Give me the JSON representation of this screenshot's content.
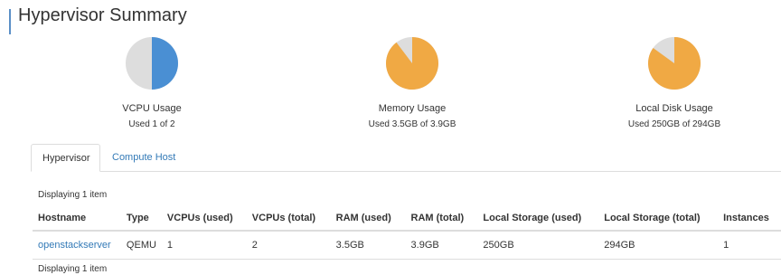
{
  "page": {
    "title": "Hypervisor Summary"
  },
  "colors": {
    "vcpu": "#4a8fd3",
    "memory": "#f0a944",
    "disk": "#f0a944",
    "free": "#dddddd",
    "link": "#337ab7"
  },
  "summary": [
    {
      "label": "VCPU Usage",
      "detail": "Used 1 of 2",
      "used_fraction": 0.5
    },
    {
      "label": "Memory Usage",
      "detail": "Used 3.5GB of 3.9GB",
      "used_fraction": 0.897
    },
    {
      "label": "Local Disk Usage",
      "detail": "Used 250GB of 294GB",
      "used_fraction": 0.85
    }
  ],
  "tabs": [
    {
      "label": "Hypervisor",
      "active": true
    },
    {
      "label": "Compute Host",
      "active": false
    }
  ],
  "table": {
    "count_top": "Displaying 1 item",
    "count_bottom": "Displaying 1 item",
    "headers": [
      "Hostname",
      "Type",
      "VCPUs (used)",
      "VCPUs (total)",
      "RAM (used)",
      "RAM (total)",
      "Local Storage (used)",
      "Local Storage (total)",
      "Instances"
    ],
    "rows": [
      [
        "openstackserver",
        "QEMU",
        "1",
        "2",
        "3.5GB",
        "3.9GB",
        "250GB",
        "294GB",
        "1"
      ]
    ]
  }
}
